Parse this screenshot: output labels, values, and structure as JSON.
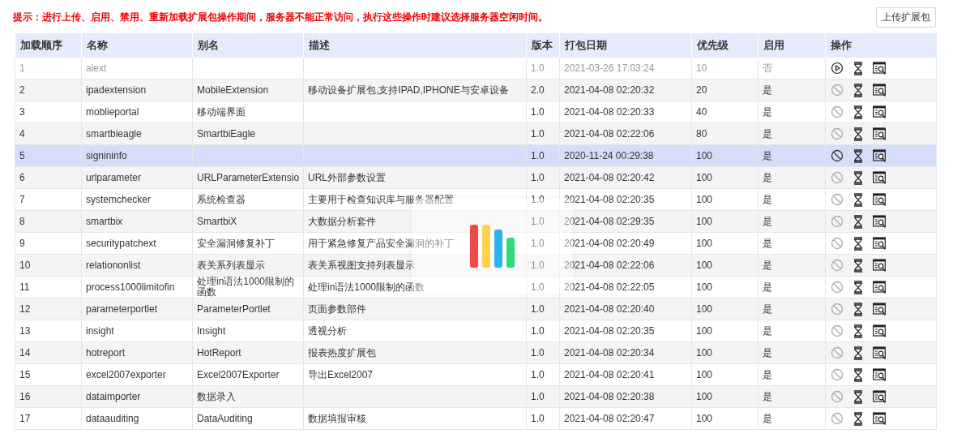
{
  "notice": "提示：进行上传、启用、禁用、重新加载扩展包操作期间，服务器不能正常访问，执行这些操作时建议选择服务器空闲时间。",
  "upload_button": "上传扩展包",
  "table": {
    "columns": [
      "加载顺序",
      "名称",
      "别名",
      "描述",
      "版本",
      "打包日期",
      "优先级",
      "启用",
      "操作"
    ],
    "rows": [
      {
        "order": "1",
        "name": "aiext",
        "alias": "",
        "description": "",
        "version": "1.0",
        "date": "2021-03-26 17:03:24",
        "priority": "10",
        "enabled_label": "否",
        "enabled": false,
        "selected": false
      },
      {
        "order": "2",
        "name": "ipadextension",
        "alias": "MobileExtension",
        "description": "移动设备扩展包,支持IPAD,IPHONE与安卓设备",
        "version": "2.0",
        "date": "2021-04-08 02:20:32",
        "priority": "20",
        "enabled_label": "是",
        "enabled": true,
        "selected": false
      },
      {
        "order": "3",
        "name": "moblieportal",
        "alias": "移动端界面",
        "description": "",
        "version": "1.0",
        "date": "2021-04-08 02:20:33",
        "priority": "40",
        "enabled_label": "是",
        "enabled": true,
        "selected": false
      },
      {
        "order": "4",
        "name": "smartbieagle",
        "alias": "SmartbiEagle",
        "description": "",
        "version": "1.0",
        "date": "2021-04-08 02:22:06",
        "priority": "80",
        "enabled_label": "是",
        "enabled": true,
        "selected": false
      },
      {
        "order": "5",
        "name": "signininfo",
        "alias": "",
        "description": "",
        "version": "1.0",
        "date": "2020-11-24 00:29:38",
        "priority": "100",
        "enabled_label": "是",
        "enabled": true,
        "selected": true
      },
      {
        "order": "6",
        "name": "urlparameter",
        "alias": "URLParameterExtensio",
        "description": "URL外部参数设置",
        "version": "1.0",
        "date": "2021-04-08 02:20:42",
        "priority": "100",
        "enabled_label": "是",
        "enabled": true,
        "selected": false
      },
      {
        "order": "7",
        "name": "systemchecker",
        "alias": "系统检查器",
        "description": "主要用于检查知识库与服务器配置",
        "version": "1.0",
        "date": "2021-04-08 02:20:35",
        "priority": "100",
        "enabled_label": "是",
        "enabled": true,
        "selected": false
      },
      {
        "order": "8",
        "name": "smartbix",
        "alias": "SmartbiX",
        "description": "大数据分析套件",
        "version": "1.0",
        "date": "2021-04-08 02:29:35",
        "priority": "100",
        "enabled_label": "是",
        "enabled": true,
        "selected": false
      },
      {
        "order": "9",
        "name": "securitypatchext",
        "alias": "安全漏洞修复补丁",
        "description": "用于紧急修复产品安全漏洞的补丁",
        "version": "1.0",
        "date": "2021-04-08 02:20:49",
        "priority": "100",
        "enabled_label": "是",
        "enabled": true,
        "selected": false
      },
      {
        "order": "10",
        "name": "relationonlist",
        "alias": "表关系列表显示",
        "description": "表关系视图支持列表显示",
        "version": "1.0",
        "date": "2021-04-08 02:22:06",
        "priority": "100",
        "enabled_label": "是",
        "enabled": true,
        "selected": false
      },
      {
        "order": "11",
        "name": "process1000limitofin",
        "alias": "处理in语法1000限制的函数",
        "description": "处理in语法1000限制的函数",
        "version": "1.0",
        "date": "2021-04-08 02:22:05",
        "priority": "100",
        "enabled_label": "是",
        "enabled": true,
        "selected": false
      },
      {
        "order": "12",
        "name": "parameterportlet",
        "alias": "ParameterPortlet",
        "description": "页面参数部件",
        "version": "1.0",
        "date": "2021-04-08 02:20:40",
        "priority": "100",
        "enabled_label": "是",
        "enabled": true,
        "selected": false
      },
      {
        "order": "13",
        "name": "insight",
        "alias": "Insight",
        "description": "透视分析",
        "version": "1.0",
        "date": "2021-04-08 02:20:35",
        "priority": "100",
        "enabled_label": "是",
        "enabled": true,
        "selected": false
      },
      {
        "order": "14",
        "name": "hotreport",
        "alias": "HotReport",
        "description": "报表热度扩展包",
        "version": "1.0",
        "date": "2021-04-08 02:20:34",
        "priority": "100",
        "enabled_label": "是",
        "enabled": true,
        "selected": false
      },
      {
        "order": "15",
        "name": "excel2007exporter",
        "alias": "Excel2007Exporter",
        "description": "导出Excel2007",
        "version": "1.0",
        "date": "2021-04-08 02:20:41",
        "priority": "100",
        "enabled_label": "是",
        "enabled": true,
        "selected": false
      },
      {
        "order": "16",
        "name": "dataimporter",
        "alias": "数据录入",
        "description": "",
        "version": "1.0",
        "date": "2021-04-08 02:20:38",
        "priority": "100",
        "enabled_label": "是",
        "enabled": true,
        "selected": false
      },
      {
        "order": "17",
        "name": "dataauditing",
        "alias": "DataAuditing",
        "description": "数据填报审核",
        "version": "1.0",
        "date": "2021-04-08 02:20:47",
        "priority": "100",
        "enabled_label": "是",
        "enabled": true,
        "selected": false
      }
    ]
  },
  "loading_overlay": {
    "visible": true
  }
}
